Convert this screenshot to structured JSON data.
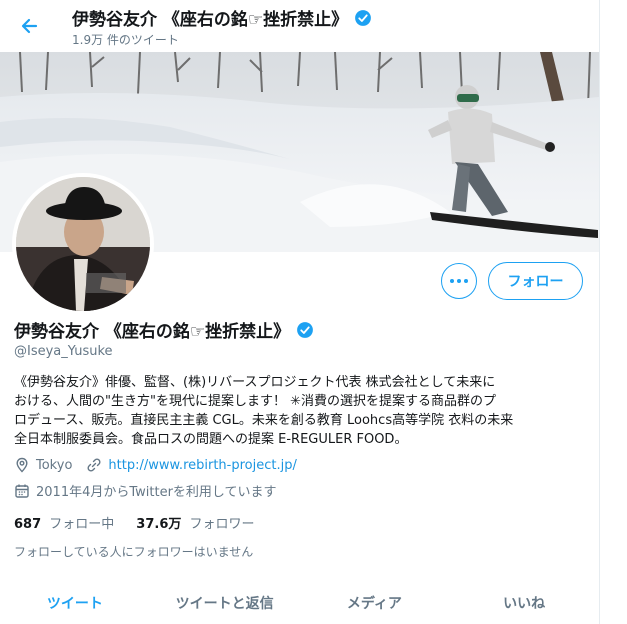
{
  "header": {
    "name": "伊勢谷友介 《座右の銘☞挫折禁止》",
    "tweet_count": "1.9万 件のツイート"
  },
  "colors": {
    "accent": "#1da1f2",
    "text": "#14171a",
    "muted": "#657786"
  },
  "icons": {
    "back": "arrow-left-icon",
    "verified": "verified-badge-icon",
    "more": "more-horizontal-icon",
    "location": "location-pin-icon",
    "link": "link-icon",
    "calendar": "calendar-icon"
  },
  "profile": {
    "name": "伊勢谷友介 《座右の銘☞挫折禁止》",
    "handle": "@Iseya_Yusuke",
    "bio": [
      "《伊勢谷友介》俳優、監督、(株)リバースプロジェクト代表 株式会社として未来に",
      "おける、人間の\"生き方\"を現代に提案します！ ✳消費の選択を提案する商品群のプ",
      "ロデュース、販売。直接民主主義 CGL。未来を創る教育 Loohcs高等学院 衣料の未来",
      "全日本制服委員会。食品ロスの問題への提案 E-REGULER FOOD。"
    ],
    "location": "Tokyo",
    "url": "http://www.rebirth-project.jp/",
    "joined": "2011年4月からTwitterを利用しています",
    "following_count": "687",
    "following_label": "フォロー中",
    "followers_count": "37.6万",
    "followers_label": "フォロワー",
    "mutual_note": "フォローしている人にフォロワーはいません"
  },
  "actions": {
    "follow_label": "フォロー"
  },
  "tabs": [
    {
      "label": "ツイート",
      "active": true
    },
    {
      "label": "ツイートと返信",
      "active": false
    },
    {
      "label": "メディア",
      "active": false
    },
    {
      "label": "いいね",
      "active": false
    }
  ]
}
